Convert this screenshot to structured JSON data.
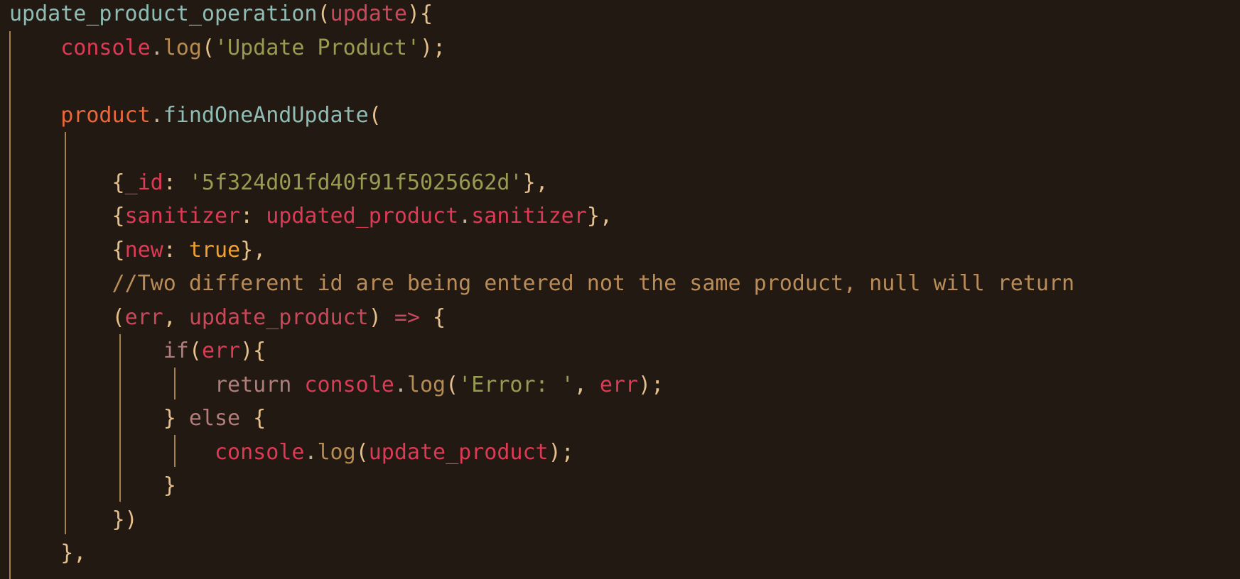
{
  "editor": {
    "background": "#211912",
    "lines": [
      {
        "id": "l1",
        "tokens": [
          {
            "t": "update_product_operation",
            "c": "tok-fn"
          },
          {
            "t": "(",
            "c": "tok-punct"
          },
          {
            "t": "update",
            "c": "tok-param"
          },
          {
            "t": "){",
            "c": "tok-punct"
          }
        ]
      },
      {
        "id": "l2",
        "tokens": [
          {
            "t": "    ",
            "c": "tok-punct"
          },
          {
            "t": "console",
            "c": "tok-obj"
          },
          {
            "t": ".",
            "c": "tok-dot"
          },
          {
            "t": "log",
            "c": "tok-method"
          },
          {
            "t": "(",
            "c": "tok-punct"
          },
          {
            "t": "'Update Product'",
            "c": "tok-str"
          },
          {
            "t": ");",
            "c": "tok-punct"
          }
        ]
      },
      {
        "id": "l3",
        "tokens": []
      },
      {
        "id": "l4",
        "tokens": [
          {
            "t": "    ",
            "c": "tok-punct"
          },
          {
            "t": "product",
            "c": "tok-prod"
          },
          {
            "t": ".",
            "c": "tok-dot"
          },
          {
            "t": "findOneAndUpdate",
            "c": "tok-call"
          },
          {
            "t": "(",
            "c": "tok-punct"
          }
        ]
      },
      {
        "id": "l5",
        "tokens": []
      },
      {
        "id": "l6",
        "tokens": [
          {
            "t": "        ",
            "c": "tok-punct"
          },
          {
            "t": "{",
            "c": "tok-punct"
          },
          {
            "t": "_id",
            "c": "tok-key"
          },
          {
            "t": ": ",
            "c": "tok-punct"
          },
          {
            "t": "'5f324d01fd40f91f5025662d'",
            "c": "tok-str"
          },
          {
            "t": "},",
            "c": "tok-punct"
          }
        ]
      },
      {
        "id": "l7",
        "tokens": [
          {
            "t": "        ",
            "c": "tok-punct"
          },
          {
            "t": "{",
            "c": "tok-punct"
          },
          {
            "t": "sanitizer",
            "c": "tok-key"
          },
          {
            "t": ": ",
            "c": "tok-punct"
          },
          {
            "t": "updated_product",
            "c": "tok-obj"
          },
          {
            "t": ".",
            "c": "tok-dot"
          },
          {
            "t": "sanitizer",
            "c": "tok-obj"
          },
          {
            "t": "},",
            "c": "tok-punct"
          }
        ]
      },
      {
        "id": "l8",
        "tokens": [
          {
            "t": "        ",
            "c": "tok-punct"
          },
          {
            "t": "{",
            "c": "tok-punct"
          },
          {
            "t": "new",
            "c": "tok-key"
          },
          {
            "t": ": ",
            "c": "tok-punct"
          },
          {
            "t": "true",
            "c": "tok-bool"
          },
          {
            "t": "},",
            "c": "tok-punct"
          }
        ]
      },
      {
        "id": "l9",
        "tokens": [
          {
            "t": "        ",
            "c": "tok-punct"
          },
          {
            "t": "//Two different id are being entered not the same product, null will return",
            "c": "tok-comment"
          }
        ]
      },
      {
        "id": "l10",
        "tokens": [
          {
            "t": "        ",
            "c": "tok-punct"
          },
          {
            "t": "(",
            "c": "tok-punct"
          },
          {
            "t": "err",
            "c": "tok-param"
          },
          {
            "t": ", ",
            "c": "tok-punct"
          },
          {
            "t": "update_product",
            "c": "tok-param"
          },
          {
            "t": ") ",
            "c": "tok-punct"
          },
          {
            "t": "=>",
            "c": "tok-arrow"
          },
          {
            "t": " {",
            "c": "tok-punct"
          }
        ]
      },
      {
        "id": "l11",
        "tokens": [
          {
            "t": "            ",
            "c": "tok-punct"
          },
          {
            "t": "if",
            "c": "tok-kw"
          },
          {
            "t": "(",
            "c": "tok-punct"
          },
          {
            "t": "err",
            "c": "tok-obj"
          },
          {
            "t": "){",
            "c": "tok-punct"
          }
        ]
      },
      {
        "id": "l12",
        "tokens": [
          {
            "t": "                ",
            "c": "tok-punct"
          },
          {
            "t": "return",
            "c": "tok-kw"
          },
          {
            "t": " ",
            "c": "tok-punct"
          },
          {
            "t": "console",
            "c": "tok-obj"
          },
          {
            "t": ".",
            "c": "tok-dot"
          },
          {
            "t": "log",
            "c": "tok-method"
          },
          {
            "t": "(",
            "c": "tok-punct"
          },
          {
            "t": "'Error: '",
            "c": "tok-str"
          },
          {
            "t": ", ",
            "c": "tok-punct"
          },
          {
            "t": "err",
            "c": "tok-obj"
          },
          {
            "t": ");",
            "c": "tok-punct"
          }
        ]
      },
      {
        "id": "l13",
        "tokens": [
          {
            "t": "            ",
            "c": "tok-punct"
          },
          {
            "t": "} ",
            "c": "tok-punct"
          },
          {
            "t": "else",
            "c": "tok-kw"
          },
          {
            "t": " {",
            "c": "tok-punct"
          }
        ]
      },
      {
        "id": "l14",
        "tokens": [
          {
            "t": "                ",
            "c": "tok-punct"
          },
          {
            "t": "console",
            "c": "tok-obj"
          },
          {
            "t": ".",
            "c": "tok-dot"
          },
          {
            "t": "log",
            "c": "tok-method"
          },
          {
            "t": "(",
            "c": "tok-punct"
          },
          {
            "t": "update_product",
            "c": "tok-obj"
          },
          {
            "t": ");",
            "c": "tok-punct"
          }
        ]
      },
      {
        "id": "l15",
        "tokens": [
          {
            "t": "            ",
            "c": "tok-punct"
          },
          {
            "t": "}",
            "c": "tok-punct"
          }
        ]
      },
      {
        "id": "l16",
        "tokens": [
          {
            "t": "        ",
            "c": "tok-punct"
          },
          {
            "t": "})",
            "c": "tok-punct"
          }
        ]
      },
      {
        "id": "l17",
        "tokens": [
          {
            "t": "    ",
            "c": "tok-punct"
          },
          {
            "t": "},",
            "c": "tok-punct"
          }
        ]
      }
    ]
  }
}
